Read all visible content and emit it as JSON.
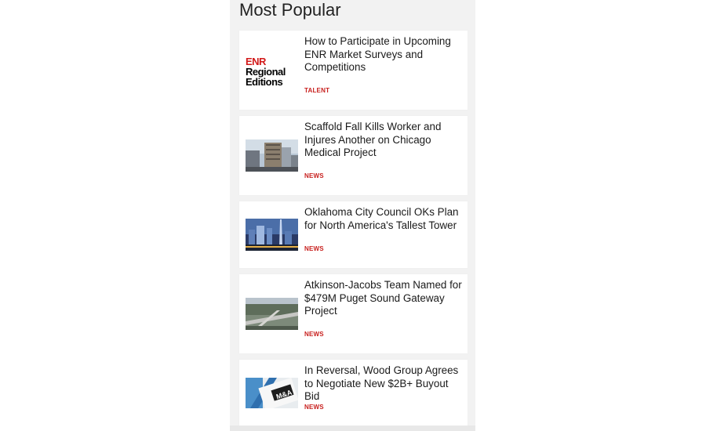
{
  "section": {
    "title": "Most Popular"
  },
  "articles": [
    {
      "headline": "How to Participate in Upcoming ENR Market Surveys and Competitions",
      "tag": "TALENT",
      "thumb": {
        "kind": "logo",
        "logo_lines": [
          "ENR",
          "Regional",
          "Editions"
        ]
      }
    },
    {
      "headline": "Scaffold Fall Kills Worker and Injures Another on Chicago Medical Project",
      "tag": "NEWS",
      "thumb": {
        "kind": "photo",
        "subject": "building-under-construction"
      }
    },
    {
      "headline": "Oklahoma City Council OKs Plan for North America's Tallest Tower",
      "tag": "NEWS",
      "thumb": {
        "kind": "photo",
        "subject": "night-skyline-tower"
      }
    },
    {
      "headline": "Atkinson-Jacobs Team Named for $479M Puget Sound Gateway Project",
      "tag": "NEWS",
      "thumb": {
        "kind": "photo",
        "subject": "highway-interchange-aerial"
      }
    },
    {
      "headline": "In Reversal, Wood Group Agrees to Negotiate New $2B+ Buyout Bid",
      "tag": "NEWS",
      "thumb": {
        "kind": "photo",
        "subject": "ma-document",
        "text": "M&A"
      }
    }
  ],
  "colors": {
    "tag": "#c8201e",
    "panel": "#f2f2f2",
    "card": "#ffffff"
  }
}
